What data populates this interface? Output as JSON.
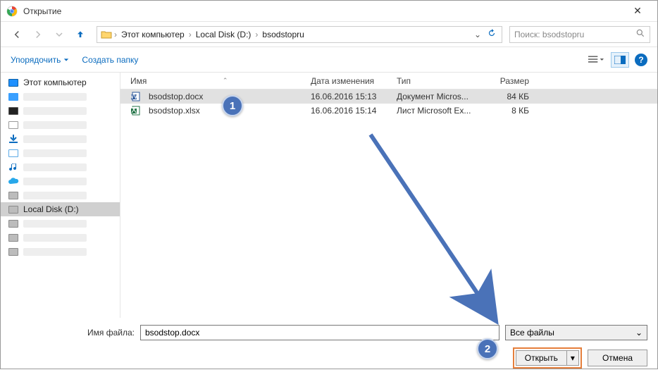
{
  "window": {
    "title": "Открытие",
    "close": "✕"
  },
  "nav": {
    "breadcrumbs": [
      "Этот компьютер",
      "Local Disk (D:)",
      "bsodstopru"
    ],
    "search_placeholder": "Поиск: bsodstopru"
  },
  "toolbar": {
    "organize": "Упорядочить",
    "new_folder": "Создать папку"
  },
  "sidebar": {
    "this_pc": "Этот компьютер",
    "local_disk": "Local Disk (D:)"
  },
  "columns": {
    "name": "Имя",
    "date": "Дата изменения",
    "type": "Тип",
    "size": "Размер"
  },
  "files": [
    {
      "name": "bsodstop.docx",
      "date": "16.06.2016 15:13",
      "type": "Документ Micros...",
      "size": "84 КБ",
      "selected": true,
      "icon": "docx"
    },
    {
      "name": "bsodstop.xlsx",
      "date": "16.06.2016 15:14",
      "type": "Лист Microsoft Ex...",
      "size": "8 КБ",
      "selected": false,
      "icon": "xlsx"
    }
  ],
  "footer": {
    "filename_label": "Имя файла:",
    "filename_value": "bsodstop.docx",
    "filter_label": "Все файлы",
    "open": "Открыть",
    "cancel": "Отмена"
  },
  "callouts": {
    "one": "1",
    "two": "2"
  }
}
